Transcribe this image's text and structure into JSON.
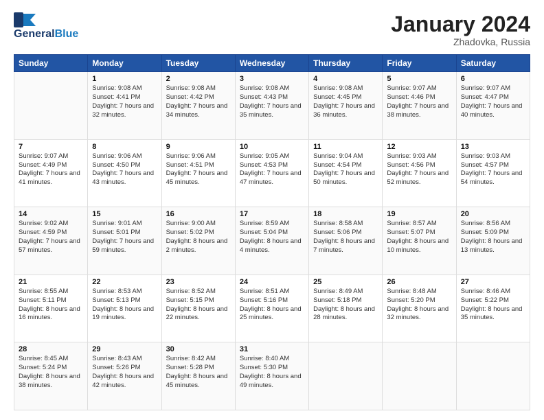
{
  "header": {
    "logo_general": "General",
    "logo_blue": "Blue",
    "title": "January 2024",
    "subtitle": "Zhadovka, Russia"
  },
  "weekdays": [
    "Sunday",
    "Monday",
    "Tuesday",
    "Wednesday",
    "Thursday",
    "Friday",
    "Saturday"
  ],
  "weeks": [
    [
      {
        "day": "",
        "sunrise": "",
        "sunset": "",
        "daylight": ""
      },
      {
        "day": "1",
        "sunrise": "Sunrise: 9:08 AM",
        "sunset": "Sunset: 4:41 PM",
        "daylight": "Daylight: 7 hours and 32 minutes."
      },
      {
        "day": "2",
        "sunrise": "Sunrise: 9:08 AM",
        "sunset": "Sunset: 4:42 PM",
        "daylight": "Daylight: 7 hours and 34 minutes."
      },
      {
        "day": "3",
        "sunrise": "Sunrise: 9:08 AM",
        "sunset": "Sunset: 4:43 PM",
        "daylight": "Daylight: 7 hours and 35 minutes."
      },
      {
        "day": "4",
        "sunrise": "Sunrise: 9:08 AM",
        "sunset": "Sunset: 4:45 PM",
        "daylight": "Daylight: 7 hours and 36 minutes."
      },
      {
        "day": "5",
        "sunrise": "Sunrise: 9:07 AM",
        "sunset": "Sunset: 4:46 PM",
        "daylight": "Daylight: 7 hours and 38 minutes."
      },
      {
        "day": "6",
        "sunrise": "Sunrise: 9:07 AM",
        "sunset": "Sunset: 4:47 PM",
        "daylight": "Daylight: 7 hours and 40 minutes."
      }
    ],
    [
      {
        "day": "7",
        "sunrise": "Sunrise: 9:07 AM",
        "sunset": "Sunset: 4:49 PM",
        "daylight": "Daylight: 7 hours and 41 minutes."
      },
      {
        "day": "8",
        "sunrise": "Sunrise: 9:06 AM",
        "sunset": "Sunset: 4:50 PM",
        "daylight": "Daylight: 7 hours and 43 minutes."
      },
      {
        "day": "9",
        "sunrise": "Sunrise: 9:06 AM",
        "sunset": "Sunset: 4:51 PM",
        "daylight": "Daylight: 7 hours and 45 minutes."
      },
      {
        "day": "10",
        "sunrise": "Sunrise: 9:05 AM",
        "sunset": "Sunset: 4:53 PM",
        "daylight": "Daylight: 7 hours and 47 minutes."
      },
      {
        "day": "11",
        "sunrise": "Sunrise: 9:04 AM",
        "sunset": "Sunset: 4:54 PM",
        "daylight": "Daylight: 7 hours and 50 minutes."
      },
      {
        "day": "12",
        "sunrise": "Sunrise: 9:03 AM",
        "sunset": "Sunset: 4:56 PM",
        "daylight": "Daylight: 7 hours and 52 minutes."
      },
      {
        "day": "13",
        "sunrise": "Sunrise: 9:03 AM",
        "sunset": "Sunset: 4:57 PM",
        "daylight": "Daylight: 7 hours and 54 minutes."
      }
    ],
    [
      {
        "day": "14",
        "sunrise": "Sunrise: 9:02 AM",
        "sunset": "Sunset: 4:59 PM",
        "daylight": "Daylight: 7 hours and 57 minutes."
      },
      {
        "day": "15",
        "sunrise": "Sunrise: 9:01 AM",
        "sunset": "Sunset: 5:01 PM",
        "daylight": "Daylight: 7 hours and 59 minutes."
      },
      {
        "day": "16",
        "sunrise": "Sunrise: 9:00 AM",
        "sunset": "Sunset: 5:02 PM",
        "daylight": "Daylight: 8 hours and 2 minutes."
      },
      {
        "day": "17",
        "sunrise": "Sunrise: 8:59 AM",
        "sunset": "Sunset: 5:04 PM",
        "daylight": "Daylight: 8 hours and 4 minutes."
      },
      {
        "day": "18",
        "sunrise": "Sunrise: 8:58 AM",
        "sunset": "Sunset: 5:06 PM",
        "daylight": "Daylight: 8 hours and 7 minutes."
      },
      {
        "day": "19",
        "sunrise": "Sunrise: 8:57 AM",
        "sunset": "Sunset: 5:07 PM",
        "daylight": "Daylight: 8 hours and 10 minutes."
      },
      {
        "day": "20",
        "sunrise": "Sunrise: 8:56 AM",
        "sunset": "Sunset: 5:09 PM",
        "daylight": "Daylight: 8 hours and 13 minutes."
      }
    ],
    [
      {
        "day": "21",
        "sunrise": "Sunrise: 8:55 AM",
        "sunset": "Sunset: 5:11 PM",
        "daylight": "Daylight: 8 hours and 16 minutes."
      },
      {
        "day": "22",
        "sunrise": "Sunrise: 8:53 AM",
        "sunset": "Sunset: 5:13 PM",
        "daylight": "Daylight: 8 hours and 19 minutes."
      },
      {
        "day": "23",
        "sunrise": "Sunrise: 8:52 AM",
        "sunset": "Sunset: 5:15 PM",
        "daylight": "Daylight: 8 hours and 22 minutes."
      },
      {
        "day": "24",
        "sunrise": "Sunrise: 8:51 AM",
        "sunset": "Sunset: 5:16 PM",
        "daylight": "Daylight: 8 hours and 25 minutes."
      },
      {
        "day": "25",
        "sunrise": "Sunrise: 8:49 AM",
        "sunset": "Sunset: 5:18 PM",
        "daylight": "Daylight: 8 hours and 28 minutes."
      },
      {
        "day": "26",
        "sunrise": "Sunrise: 8:48 AM",
        "sunset": "Sunset: 5:20 PM",
        "daylight": "Daylight: 8 hours and 32 minutes."
      },
      {
        "day": "27",
        "sunrise": "Sunrise: 8:46 AM",
        "sunset": "Sunset: 5:22 PM",
        "daylight": "Daylight: 8 hours and 35 minutes."
      }
    ],
    [
      {
        "day": "28",
        "sunrise": "Sunrise: 8:45 AM",
        "sunset": "Sunset: 5:24 PM",
        "daylight": "Daylight: 8 hours and 38 minutes."
      },
      {
        "day": "29",
        "sunrise": "Sunrise: 8:43 AM",
        "sunset": "Sunset: 5:26 PM",
        "daylight": "Daylight: 8 hours and 42 minutes."
      },
      {
        "day": "30",
        "sunrise": "Sunrise: 8:42 AM",
        "sunset": "Sunset: 5:28 PM",
        "daylight": "Daylight: 8 hours and 45 minutes."
      },
      {
        "day": "31",
        "sunrise": "Sunrise: 8:40 AM",
        "sunset": "Sunset: 5:30 PM",
        "daylight": "Daylight: 8 hours and 49 minutes."
      },
      {
        "day": "",
        "sunrise": "",
        "sunset": "",
        "daylight": ""
      },
      {
        "day": "",
        "sunrise": "",
        "sunset": "",
        "daylight": ""
      },
      {
        "day": "",
        "sunrise": "",
        "sunset": "",
        "daylight": ""
      }
    ]
  ]
}
